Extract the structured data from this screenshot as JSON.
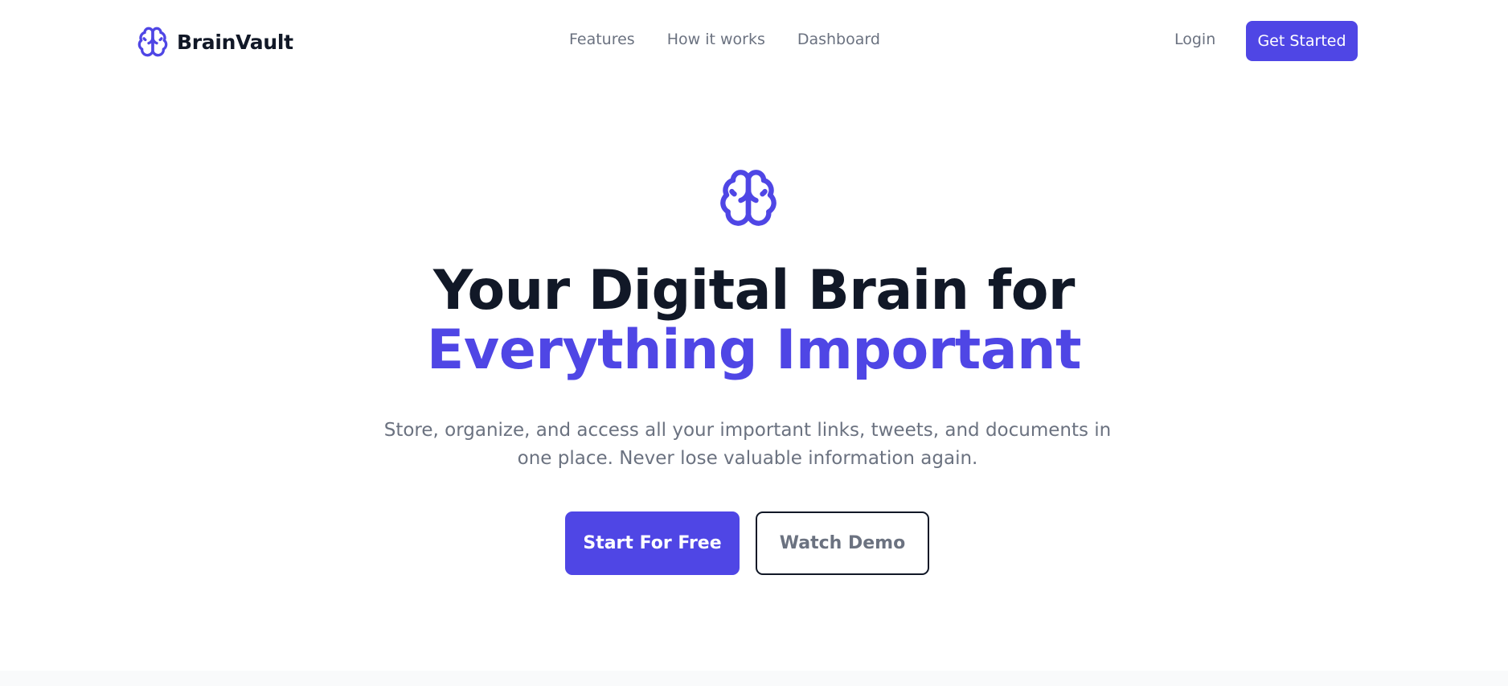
{
  "brand": {
    "name": "BrainVault",
    "icon": "brain-icon",
    "accent_color": "#4f46e5"
  },
  "nav": {
    "links": [
      {
        "label": "Features"
      },
      {
        "label": "How it works"
      },
      {
        "label": "Dashboard"
      }
    ],
    "login_label": "Login",
    "get_started_label": "Get Started"
  },
  "hero": {
    "icon": "brain-icon",
    "title_line1": "Your Digital Brain for",
    "title_line2": "Everything Important",
    "subtitle": "Store, organize, and access all your important links, tweets, and documents in one place. Never lose valuable information again.",
    "primary_cta": "Start For Free",
    "secondary_cta": "Watch Demo"
  },
  "colors": {
    "primary": "#4f46e5",
    "heading": "#111827",
    "muted": "#6b7280",
    "section_bg": "#f9fafb"
  }
}
